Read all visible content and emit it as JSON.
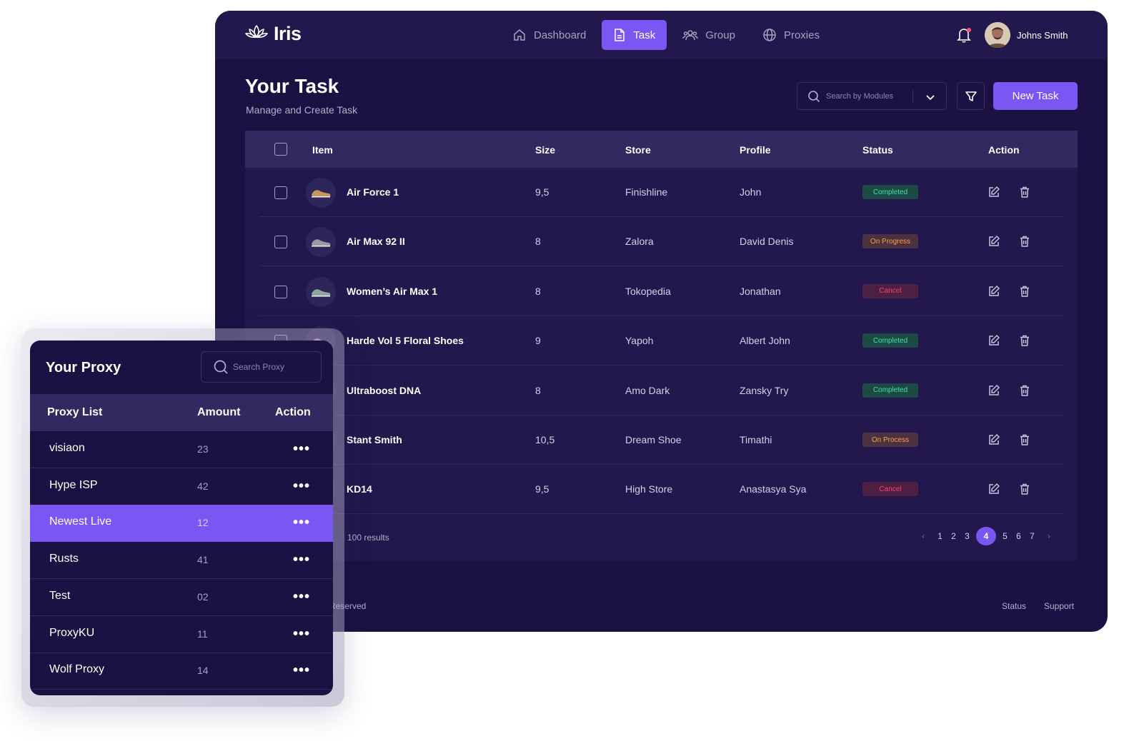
{
  "app": {
    "brand": "Iris",
    "nav": [
      {
        "label": "Dashboard",
        "icon": "home-icon",
        "active": false
      },
      {
        "label": "Task",
        "icon": "document-icon",
        "active": true
      },
      {
        "label": "Group",
        "icon": "users-icon",
        "active": false
      },
      {
        "label": "Proxies",
        "icon": "globe-icon",
        "active": false
      }
    ],
    "user": {
      "name": "Johns Smith"
    }
  },
  "page": {
    "title": "Your Task",
    "subtitle": "Manage and Create Task",
    "search_placeholder": "Search by Modules",
    "new_task_label": "New Task"
  },
  "table": {
    "headers": {
      "item": "Item",
      "size": "Size",
      "store": "Store",
      "profile": "Profile",
      "status": "Status",
      "action": "Action"
    },
    "rows": [
      {
        "item": "Air Force 1",
        "size": "9,5",
        "store": "Finishline",
        "profile": "John",
        "status": "Completed",
        "status_type": "completed"
      },
      {
        "item": "Air Max 92 II",
        "size": "8",
        "store": "Zalora",
        "profile": "David Denis",
        "status": "On Progress",
        "status_type": "progress"
      },
      {
        "item": "Women’s Air Max 1",
        "size": "8",
        "store": "Tokopedia",
        "profile": "Jonathan",
        "status": "Cancel",
        "status_type": "cancel"
      },
      {
        "item": "Harde Vol 5 Floral Shoes",
        "size": "9",
        "store": "Yapoh",
        "profile": "Albert John",
        "status": "Completed",
        "status_type": "completed"
      },
      {
        "item": "Ultraboost DNA",
        "size": "8",
        "store": "Amo Dark",
        "profile": "Zansky Try",
        "status": "Completed",
        "status_type": "completed"
      },
      {
        "item": "Stant Smith",
        "size": "10,5",
        "store": "Dream Shoe",
        "profile": "Timathi",
        "status": "On Process",
        "status_type": "progress"
      },
      {
        "item": "KD14",
        "size": "9,5",
        "store": "High Store",
        "profile": "Anastasya Sya",
        "status": "Cancel",
        "status_type": "cancel"
      }
    ],
    "results_text": "100 results",
    "pagination": {
      "prev": "‹",
      "next": "›",
      "pages": [
        "1",
        "2",
        "3",
        "4",
        "5",
        "6",
        "7"
      ],
      "current": "4"
    }
  },
  "footer": {
    "left_text": "Reserved",
    "status_link": "Status",
    "support_link": "Support"
  },
  "proxy": {
    "title": "Your Proxy",
    "search_placeholder": "Search Proxy",
    "headers": {
      "list": "Proxy List",
      "amount": "Amount",
      "action": "Action"
    },
    "rows": [
      {
        "name": "visiaon",
        "amount": "23",
        "active": false
      },
      {
        "name": "Hype ISP",
        "amount": "42",
        "active": false
      },
      {
        "name": "Newest Live",
        "amount": "12",
        "active": true
      },
      {
        "name": "Rusts",
        "amount": "41",
        "active": false
      },
      {
        "name": "Test",
        "amount": "02",
        "active": false
      },
      {
        "name": "ProxyKU",
        "amount": "11",
        "active": false
      },
      {
        "name": "Wolf Proxy",
        "amount": "14",
        "active": false
      }
    ],
    "more_label": "•••"
  },
  "colors": {
    "accent": "#7a56f2",
    "bg": "#1b1142",
    "surface": "#22184d",
    "header": "#33285f"
  }
}
